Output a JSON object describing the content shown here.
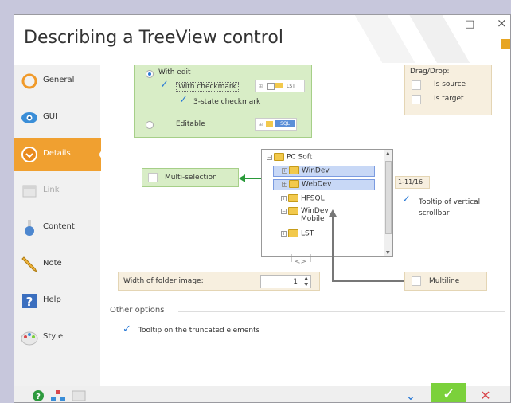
{
  "window": {
    "title": "Describing a TreeView control",
    "maximize_icon": "□",
    "close_icon": "×"
  },
  "sidebar": {
    "items": [
      {
        "label": "General",
        "icon": "general-icon"
      },
      {
        "label": "GUI",
        "icon": "eye-icon"
      },
      {
        "label": "Details",
        "icon": "details-icon",
        "active": true
      },
      {
        "label": "Link",
        "icon": "link-icon",
        "disabled": true
      },
      {
        "label": "Content",
        "icon": "flask-icon"
      },
      {
        "label": "Note",
        "icon": "pencil-icon"
      },
      {
        "label": "Help",
        "icon": "help-icon"
      },
      {
        "label": "Style",
        "icon": "palette-icon"
      }
    ]
  },
  "edit_group": {
    "with_edit": "With edit",
    "with_checkmark": "With checkmark",
    "state3": "3-state checkmark",
    "editable": "Editable",
    "preview_lst": "LST",
    "preview_sql": "SQL"
  },
  "dragdrop": {
    "title": "Drag/Drop:",
    "is_source": "Is source",
    "is_target": "Is target"
  },
  "multiselection": {
    "label": "Multi-selection"
  },
  "tree": {
    "nodes": [
      "PC Soft",
      "WinDev",
      "WebDev",
      "HFSQL",
      "WinDev\nMobile",
      "LST"
    ]
  },
  "counter": {
    "text": "1-11/16"
  },
  "tooltip_vscroll": {
    "label": "Tooltip of vertical scrollbar"
  },
  "folder_width": {
    "label": "Width of folder image:",
    "value": "1"
  },
  "multiline": {
    "label": "Multiline"
  },
  "resize_indicator": "<>",
  "other_options": {
    "title": "Other options",
    "tooltip_truncated": "Tooltip on the truncated elements"
  },
  "colors": {
    "accent": "#f0a030",
    "green_group": "#d8edc6",
    "beige_group": "#f7efdf",
    "check_blue": "#2a7ad6",
    "ok_green": "#7bd13b",
    "cancel_red": "#d9464b"
  }
}
